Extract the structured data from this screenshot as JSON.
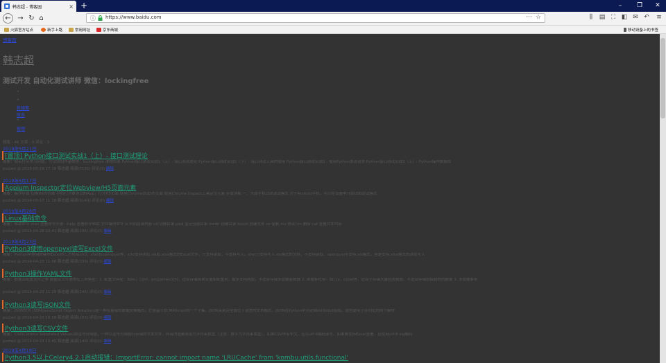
{
  "browser": {
    "tab_title": "韩志超 - 博客园",
    "url": "https://www.baidu.com",
    "bookmarks": [
      "火狐官方站点",
      "新手上路",
      "常用网址",
      "京东商城"
    ],
    "mobile_bookmarks": "移动设备上的书签"
  },
  "blog": {
    "home_link": "博客园",
    "name": "韩志超",
    "subtitle": "测试开发 自动化测试讲师 微信：lockingfree",
    "nav": [
      "新随笔",
      "联系",
      "管理"
    ],
    "stats": "随笔 - 46  文章 - 0  评论 - 3"
  },
  "posts": [
    {
      "date": "2019年5月21日",
      "title": "[置顶] Python接口测试实战1（上）- 接口测试理论",
      "summary": "摘要：如有任何学习问题，可以添加作者微信：lockingfree 课程目录 Python接口测试实战1（上）- 接口测试理论 Python接口测试实战1（下）- 接口测试工具的使用 Python接口测试实战2 - 使用Python发送请求 Python接口测试实战3（上）- Python操作数据库",
      "meta": "posted @ 2018-05-19 17:18 韩志超 阅读(7191) 评论(3)",
      "edit": "编辑"
    },
    {
      "date": "2019年5月17日",
      "title": "Appium Inspector定位Webview/H5页面元素",
      "summary": "摘要：操作步骤 切换到H5页面 手机打开要测试的App，打开H5页面 使用Chrome调试H5页面 使用Chrome Inspect工具定位元素 步骤详解 一、开启手机USB调试模式 对于Android手机，可以在设置中开启USB调试模式",
      "meta": "posted @ 2019-05-17 11:18 韩志超 阅读(1143) 评论(0)",
      "edit": "编辑"
    },
    {
      "date": "2019年4月28日",
      "title": "Linux基础命令",
      "summary": "摘要：帮助命令 man 查看命令手册 --help 查看命令帮助 文件操作命令 ls 列出目录内容 cd 切换目录 pwd 显示当前目录 mkdir 创建目录 touch 创建文件 cp 复制 mv 移动 rm 删除 cat 查看文件内容",
      "meta": "posted @ 2019-04-28 22:41 韩志超 阅读(195) 评论(0)",
      "edit": "编辑"
    },
    {
      "date": "2019年4月23日",
      "title": "Python3使用openpyxl读写Excel文件",
      "summary": "摘要：Python中常用的操作Excel的三方包有xlrd，xlwt和openpyxl等，xlrd支持读取.xls和.xlsx格式的Excel文件，只支持读取，不支持写入。xlwt只支持写入.xls格式的文件，不支持读取。openpyxl不支持.xls格式，但是支持.xlsx格式的读取写入",
      "meta": "posted @ 2019-04-23 11:56 韩志超 阅读(339) 评论(0)",
      "edit": "编辑"
    },
    {
      "date": "",
      "title": "Python3操作YAML文件",
      "summary": "摘要：数据及配置文件之争 数据及文件通常有三种类型：1. 配置文件型：如ini，conf，properties文件，适合存储简单变量和配置项，最多支持两层，不适合存储多层嵌套数据 2. 表格矩阵型：如csv，excel等，适合于存储大量同类数据，不适合存储层级结构的数据 3. 多层嵌套型",
      "meta": "posted @ 2019-04-23 11:29 韩志超 阅读(245) 评论(0)",
      "edit": "编辑"
    },
    {
      "date": "",
      "title": "Python3读写JSON文件",
      "summary": "摘要：JSON文件 JSON(JavaScript Object Notation)是一种轻量级的数据交换格式。它是基于ECMAScript的一个子集。JSON采用完全独立于语言的文本格式。JSON在Python中分别由list和dict组成。这些是用于序列化的两个模块",
      "meta": "posted @ 2019-04-23 10:58 韩志超 阅读(203) 评论(0)",
      "edit": "编辑"
    },
    {
      "date": "",
      "title": "Python3读写CSV文件",
      "summary": "摘要：CSV(Comma Separated Values)即逗号分隔值，一种以逗号分隔按行存储的文本文件，所有的值都表现为字符串类型（注意：数字为字符串类型）。如果CSV中有中文，应以utf-8编码读写，如果要支持Excel查看，应使用utf-8-sig编码",
      "meta": "posted @ 2019-04-23 10:45 韩志超 阅读(146) 评论(0)",
      "edit": "编辑"
    },
    {
      "date": "2019年4月18日",
      "title": "Python3.5以上Celery4.2.1启动报错：ImportError: cannot import name 'LRUCache' from 'kombu.utils.functional'",
      "summary": "",
      "meta": "",
      "edit": ""
    }
  ],
  "colors": {
    "tabbar": "#0b1a52",
    "page_bg": "#333333",
    "link": "#2b48d8",
    "title": "#1f9e7a",
    "accent": "#e06a2b"
  }
}
